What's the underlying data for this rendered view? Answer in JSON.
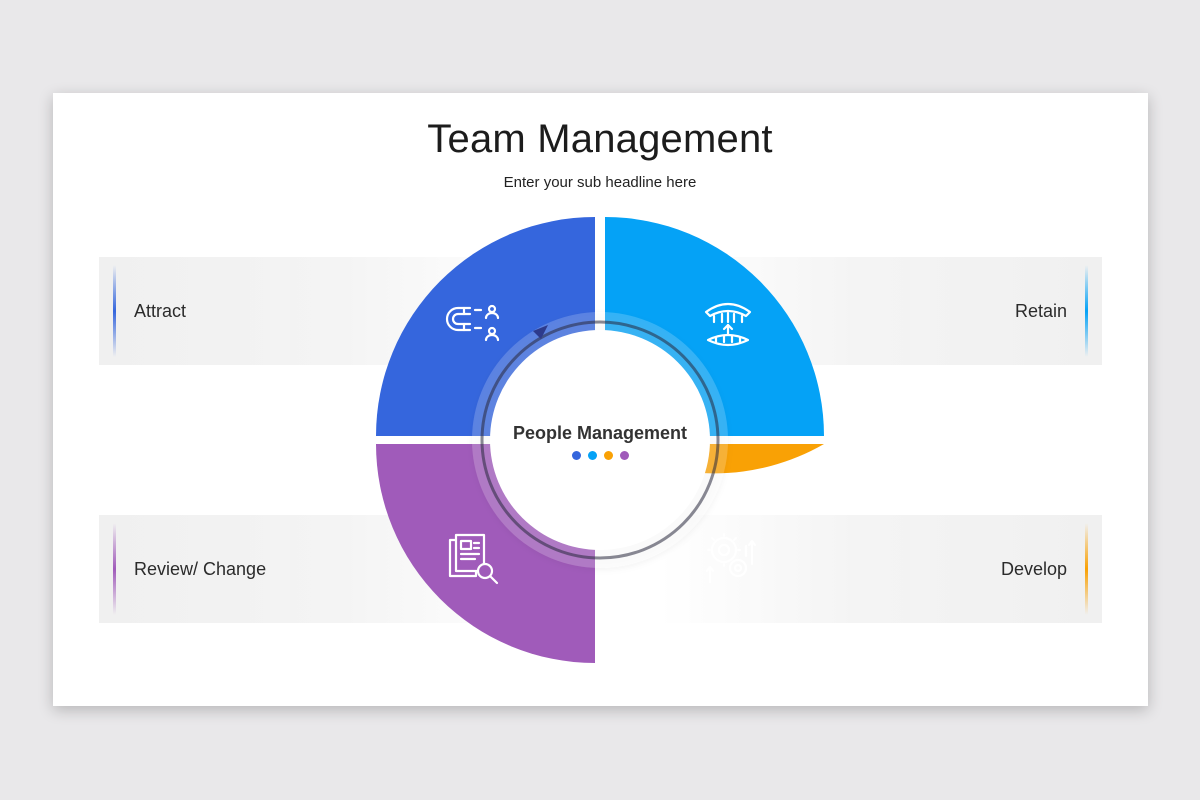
{
  "title": "Team Management",
  "subtitle": "Enter your sub headline here",
  "center": {
    "label": "People Management"
  },
  "segments": [
    {
      "label": "Attract",
      "color": "#3566dd",
      "icon": "magnet-people-icon"
    },
    {
      "label": "Retain",
      "color": "#05a2f6",
      "icon": "teeth-retainer-icon"
    },
    {
      "label": "Review/ Change",
      "color": "#a05bba",
      "icon": "document-review-icon"
    },
    {
      "label": "Develop",
      "color": "#f9a105",
      "icon": "growth-gears-icon"
    }
  ]
}
